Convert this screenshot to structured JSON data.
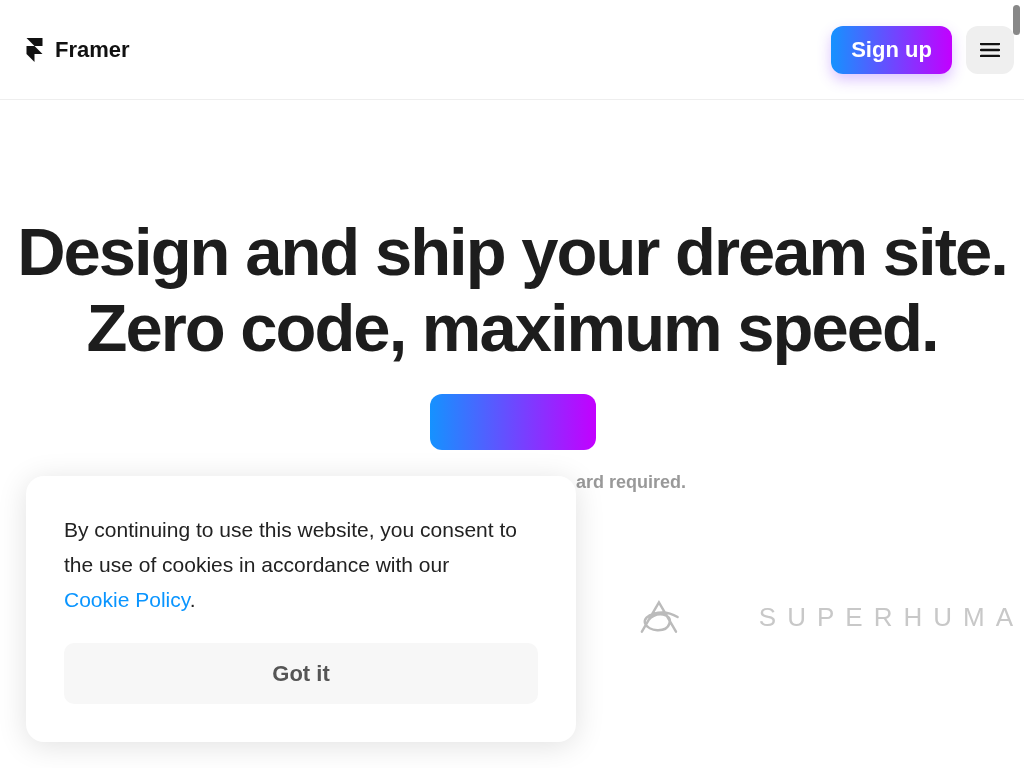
{
  "header": {
    "brand": "Framer",
    "signup": "Sign up"
  },
  "hero": {
    "headline": "Design and ship your dream site. Zero code, maximum speed.",
    "caption": "ard required."
  },
  "logos": {
    "wordmark": "SUPERHUMA"
  },
  "cookie_banner": {
    "text_before": "By continuing to use this website, you consent to the use of cookies in accordance with our ",
    "link": "Cookie Policy",
    "text_after": ".",
    "button": "Got it"
  }
}
